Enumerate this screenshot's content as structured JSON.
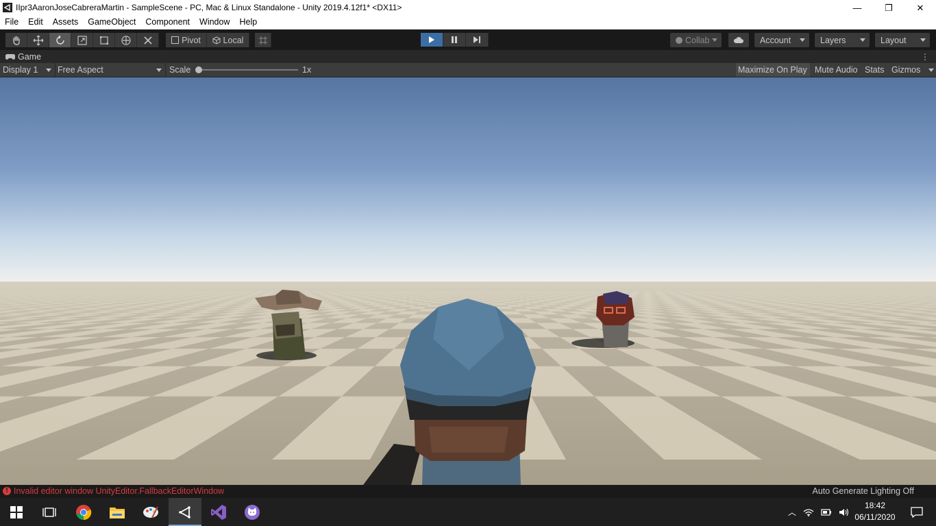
{
  "window": {
    "title": "IIpr3AaronJoseCabreraMartin - SampleScene - PC, Mac & Linux Standalone - Unity 2019.4.12f1* <DX11>",
    "controls": {
      "minimize": "—",
      "restore": "❐",
      "close": "✕"
    }
  },
  "menu": [
    "File",
    "Edit",
    "Assets",
    "GameObject",
    "Component",
    "Window",
    "Help"
  ],
  "toolbar": {
    "tools": [
      "hand-tool",
      "move-tool",
      "rotate-tool",
      "scale-tool",
      "rect-tool",
      "transform-tool",
      "custom-tool"
    ],
    "active_tool": "rotate-tool",
    "pivot_label": "Pivot",
    "local_label": "Local",
    "play_state": "playing",
    "collab_label": "Collab",
    "account_label": "Account",
    "layers_label": "Layers",
    "layout_label": "Layout",
    "play_color": "#3c6ea5"
  },
  "game_tab": {
    "label": "Game"
  },
  "game_bar": {
    "display": "Display 1",
    "aspect": "Free Aspect",
    "scale_label": "Scale",
    "scale_value": "1x",
    "maximize_on_play": "Maximize On Play",
    "mute_audio": "Mute Audio",
    "stats": "Stats",
    "gizmos": "Gizmos"
  },
  "status": {
    "error": "Invalid editor window UnityEditor.FallbackEditorWindow",
    "right": "Auto Generate Lighting Off",
    "error_color": "#d63c3c"
  },
  "taskbar": {
    "apps": [
      "windows-start-icon",
      "task-view-icon",
      "chrome-icon",
      "file-explorer-icon",
      "paint-icon",
      "unity-icon",
      "visual-studio-icon",
      "github-desktop-icon"
    ],
    "active_app": "unity-icon",
    "time": "18:42",
    "date": "06/11/2020"
  }
}
